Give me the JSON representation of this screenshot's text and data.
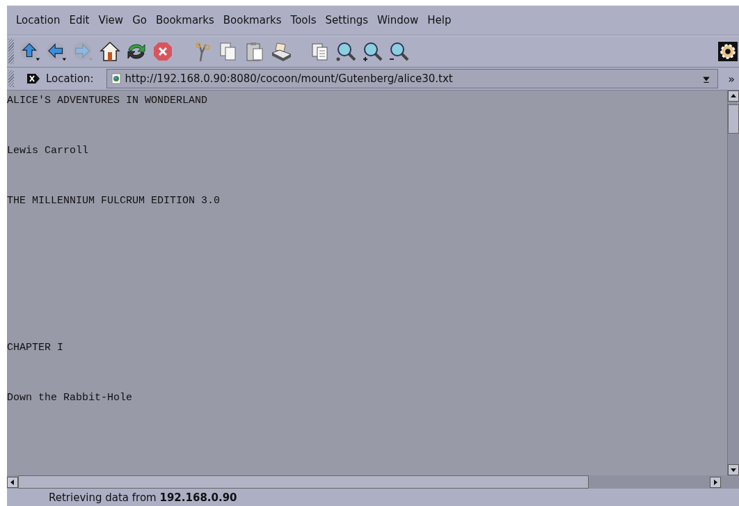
{
  "menu": [
    "Location",
    "Edit",
    "View",
    "Go",
    "Bookmarks",
    "Bookmarks",
    "Tools",
    "Settings",
    "Window",
    "Help"
  ],
  "toolbar": [
    {
      "kind": "up"
    },
    {
      "kind": "back"
    },
    {
      "kind": "forward",
      "disabled": true
    },
    {
      "kind": "home"
    },
    {
      "kind": "reload"
    },
    {
      "kind": "stop"
    },
    {
      "kind": "sep"
    },
    {
      "kind": "cut"
    },
    {
      "kind": "copy"
    },
    {
      "kind": "paste"
    },
    {
      "kind": "print"
    },
    {
      "kind": "sep"
    },
    {
      "kind": "source"
    },
    {
      "kind": "find"
    },
    {
      "kind": "zoom-in"
    },
    {
      "kind": "zoom-out"
    }
  ],
  "location": {
    "label": "Location:",
    "value": "http://192.168.0.90:8080/cocoon/mount/Gutenberg/alice30.txt",
    "more": "»"
  },
  "sections": [
    [
      "ALICE'S ADVENTURES IN WONDERLAND",
      "Lewis Carroll",
      "THE MILLENNIUM FULCRUM EDITION 3.0"
    ],
    [
      "CHAPTER I",
      "Down the Rabbit-Hole"
    ]
  ],
  "status_bar": "Retrieving data from **192.168.0.90**"
}
